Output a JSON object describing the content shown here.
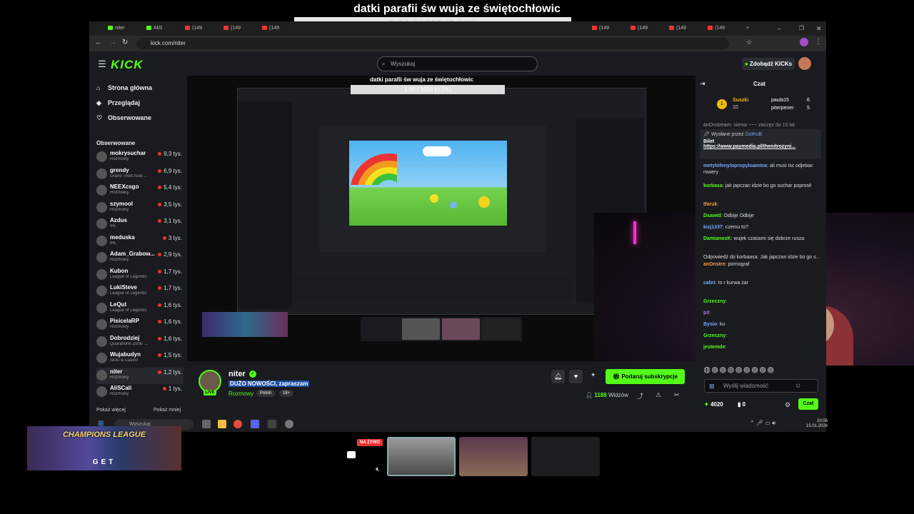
{
  "overlay": {
    "title": "datki parafii św wuja ze świętochłowic",
    "progress_text": "1.00 / 1020 (0.1%)",
    "progress_fraction": 0.001
  },
  "browser": {
    "url": "kick.com/niter",
    "tabs": [
      "niter",
      "AliS",
      "(149",
      "(149",
      "(149",
      "(149",
      "(149",
      "(149",
      "(149",
      "(149"
    ]
  },
  "header": {
    "logo": "KICK",
    "search_placeholder": "Wyszukaj",
    "kicks_button": "Zdobądź KICKs"
  },
  "sidebar": {
    "nav": [
      {
        "icon": "home-icon",
        "label": "Strona główna"
      },
      {
        "icon": "compass-icon",
        "label": "Przeglądaj"
      },
      {
        "icon": "heart-icon",
        "label": "Obserwowane"
      }
    ],
    "followed_heading": "Obserwowane",
    "channels": [
      {
        "name": "mokrysuchar",
        "category": "Rozmowy",
        "viewers": "9,3 tys."
      },
      {
        "name": "grendy",
        "category": "Grand Theft Auto ...",
        "viewers": "6,9 tys."
      },
      {
        "name": "NEEXcsgo",
        "category": "Rozmowy",
        "viewers": "5,4 tys."
      },
      {
        "name": "szymool",
        "category": "Rozmowy",
        "viewers": "3,5 tys."
      },
      {
        "name": "Azdus",
        "category": "IRL",
        "viewers": "3,1 tys."
      },
      {
        "name": "meduska",
        "category": "IRL",
        "viewers": "3 tys."
      },
      {
        "name": "Adam_Grabow...",
        "category": "Rozmowy",
        "viewers": "2,9 tys."
      },
      {
        "name": "Kubon",
        "category": "League of Legends",
        "viewers": "1,7 tys."
      },
      {
        "name": "LukiSteve",
        "category": "League of Legends",
        "viewers": "1,7 tys."
      },
      {
        "name": "LeQut",
        "category": "League of Legends",
        "viewers": "1,6 tys."
      },
      {
        "name": "PisicelaRP",
        "category": "Rozmowy",
        "viewers": "1,6 tys."
      },
      {
        "name": "Dobrodziej",
        "category": "Quarantine Zone: ...",
        "viewers": "1,6 tys."
      },
      {
        "name": "Wujabudyn",
        "category": "Slots & Casino",
        "viewers": "1,5 tys."
      },
      {
        "name": "niter",
        "category": "Rozmowy",
        "viewers": "1,2 tys."
      },
      {
        "name": "AliSCali",
        "category": "Rozmowy",
        "viewers": "1 tys."
      }
    ],
    "show_more": "Pokaż więcej",
    "show_less": "Pokaż mniej"
  },
  "inner_overlay": {
    "title": "datki parafii św wuja ze świętochłowic",
    "progress_text": "1.00 / 1020 (0.1%)"
  },
  "stream": {
    "streamer": "niter",
    "title": "DUŻO NOWOŚCI, zapraszam",
    "category": "Rozmowy",
    "tags": [
      "Polish",
      "18+"
    ],
    "live_badge": "LIVE",
    "gift_sub_button": "Podaruj subskrypcje",
    "viewers": "1188",
    "viewers_label": "Widzów"
  },
  "chat": {
    "title": "Czat",
    "leaderboard": {
      "top_label": "Suszki",
      "top_count": "10",
      "entries": [
        {
          "name": "paula15",
          "count": "6"
        },
        {
          "name": "piterpener",
          "count": "5"
        }
      ]
    },
    "top_snippet": "anOnstream: siema ~~~ zaczęz do 15 lat",
    "pinned": {
      "label": "Wysłane przez",
      "by": "DziKuB",
      "title": "Bilet",
      "link": "https://www.paymedia.pl/thenitrozyni..."
    },
    "messages": [
      {
        "user": "metylofenylopropyloamina",
        "text": "ali musi isc odjebac rowery",
        "color": "#7aa7ff"
      },
      {
        "user": "korbasa",
        "text": "jak japczan idzie bo go suchar poprosił",
        "color": "#53fc18"
      },
      {
        "user": "tfaruk",
        "text": "",
        "color": "#ff9a3c"
      },
      {
        "user": "Dsawid",
        "text": "Odbije Odbije",
        "color": "#53fc18"
      },
      {
        "user": "kizj1337",
        "text": "czemu to?",
        "color": "#7aa7ff"
      },
      {
        "user": "DamianosK",
        "text": "wujek czasami się dobrze rusza",
        "color": "#53fc18"
      },
      {
        "user": "",
        "text": "Odpowiedź do korbaasa: Jak japczan idzie bo go s...",
        "color": "#999"
      },
      {
        "user": "anOnstre",
        "text": "pornograf",
        "color": "#ff9a3c"
      },
      {
        "user": "cabri",
        "text": "to r kurwa żar",
        "color": "#7aa7ff"
      },
      {
        "user": "Grzeczny",
        "text": "",
        "color": "#53fc18"
      },
      {
        "user": "p3",
        "text": "",
        "color": "#b07aff"
      },
      {
        "user": "Bysio",
        "text": "ku",
        "color": "#7aa7ff"
      },
      {
        "user": "Grzeczny",
        "text": "",
        "color": "#53fc18"
      },
      {
        "user": "jestemde",
        "text": "",
        "color": "#53fc18"
      }
    ],
    "input_placeholder": "Wyślij wiadomość",
    "points": "4020",
    "zero": "0",
    "send_button": "Czat"
  },
  "taskbar": {
    "search_placeholder": "Wyszukaj",
    "time": "20:06",
    "date": "15.01.2026"
  },
  "overlays": {
    "champions_text": "CHAMPIONS LEAGUE",
    "champions_get": "GET",
    "live_label": "NA ŻYWO"
  },
  "colors": {
    "kick_green": "#53fc18",
    "panel_bg": "#191b1f",
    "live_red": "#e33"
  }
}
